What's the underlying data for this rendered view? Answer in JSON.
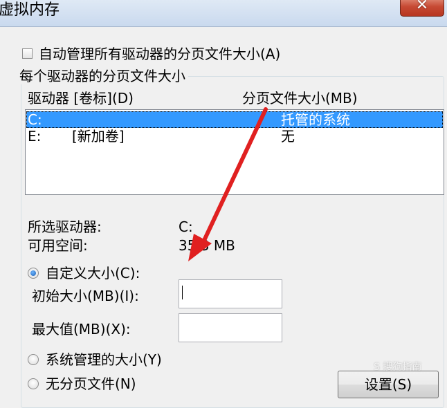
{
  "window": {
    "title": "虚拟内存",
    "close_glyph": "✕"
  },
  "auto_manage": {
    "label": "自动管理所有驱动器的分页文件大小(A)",
    "checked": false
  },
  "group": {
    "title": "每个驱动器的分页文件大小",
    "columns": [
      "驱动器 [卷标](D)",
      "分页文件大小(MB)"
    ],
    "drives": [
      {
        "drive": "C:",
        "volume": "",
        "size": "托管的系统",
        "selected": true
      },
      {
        "drive": "E:",
        "volume": "[新加卷]",
        "size": "无",
        "selected": false
      }
    ]
  },
  "selected_drive": {
    "drive_label": "所选驱动器:",
    "drive_value": "C:",
    "space_label": "可用空间:",
    "space_value": "35 3 MB"
  },
  "options": {
    "custom_label": "自定义大小(C):",
    "custom_checked": true,
    "initial_label": "初始大小(MB)(I):",
    "initial_value": "",
    "max_label": "最大值(MB)(X):",
    "max_value": "",
    "system_label": "系统管理的大小(Y)",
    "none_label": "无分页文件(N)"
  },
  "set_button": "设置(S)",
  "watermark": "S 搜狗指南",
  "colors": {
    "selection": "#3399ff",
    "annotation_arrow": "#e02020"
  }
}
